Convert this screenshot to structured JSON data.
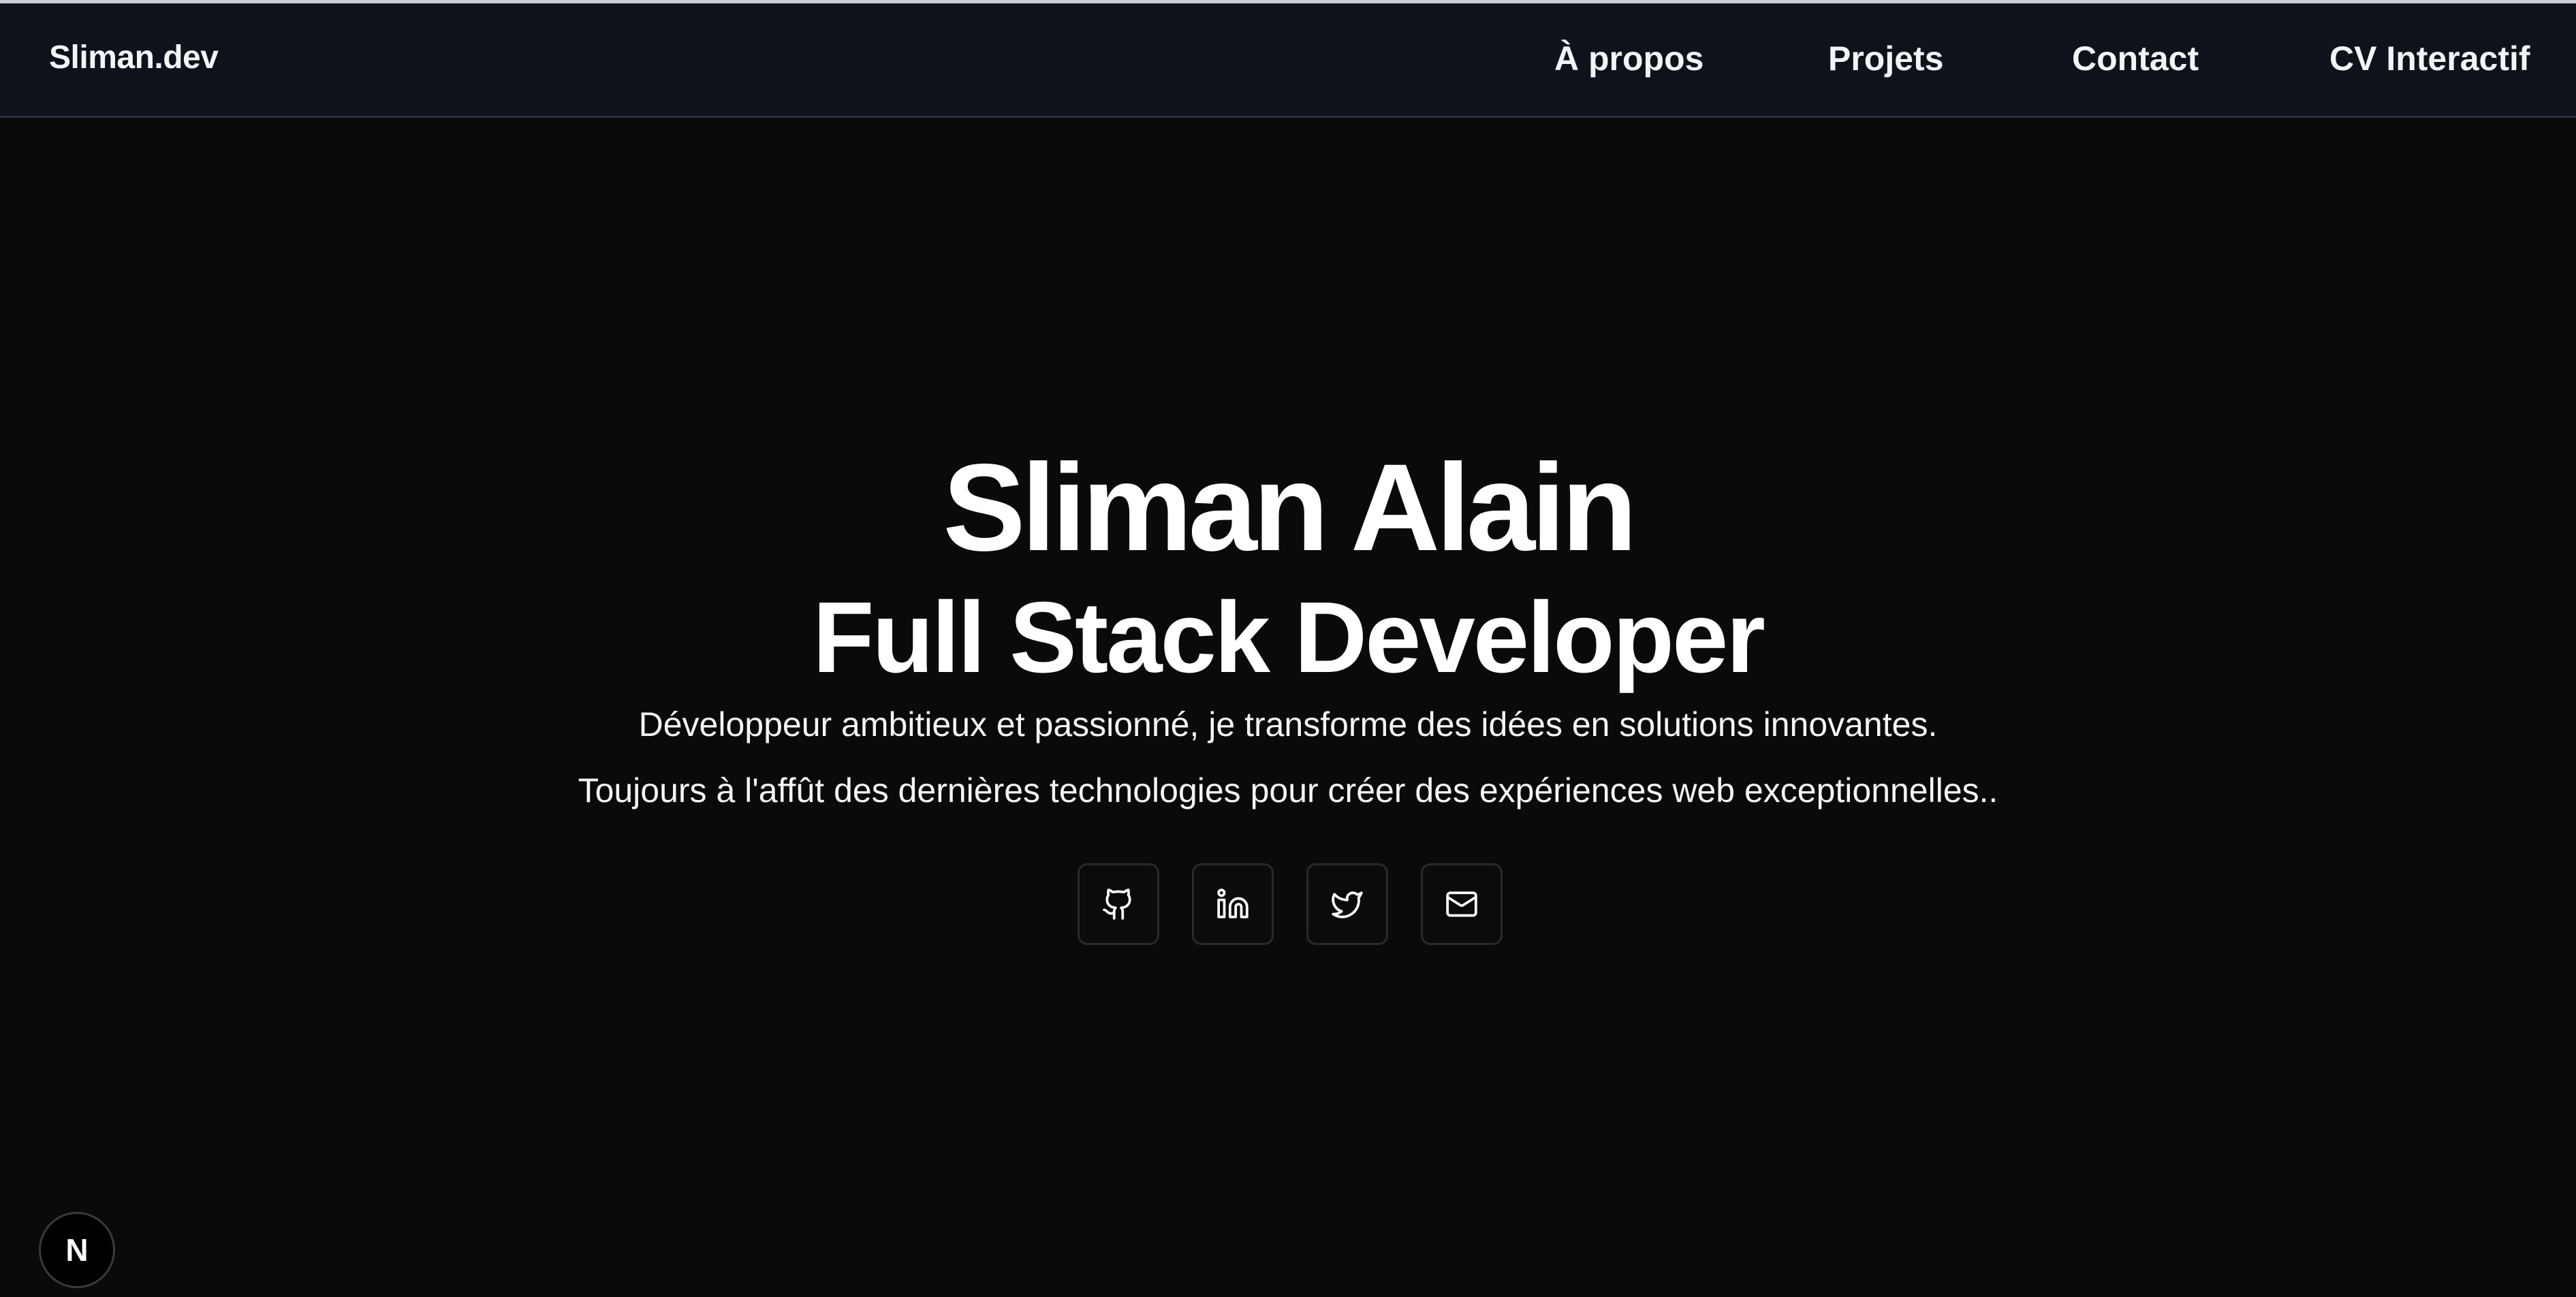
{
  "nav": {
    "brand": "Sliman.dev",
    "items": [
      {
        "label": "À propos"
      },
      {
        "label": "Projets"
      },
      {
        "label": "Contact"
      },
      {
        "label": "CV Interactif"
      }
    ]
  },
  "hero": {
    "name": "Sliman Alain",
    "role": "Full Stack Developer",
    "line1": "Développeur ambitieux et passionné, je transforme des idées en solutions innovantes.",
    "line2": "Toujours à l'affût des dernières technologies pour créer des expériences web exceptionnelles.."
  },
  "social": [
    {
      "icon": "github-icon"
    },
    {
      "icon": "linkedin-icon"
    },
    {
      "icon": "twitter-icon"
    },
    {
      "icon": "mail-icon"
    }
  ],
  "badge": {
    "letter": "N"
  },
  "colors": {
    "background": "#0a0a0a",
    "navbar": "#0d121b",
    "text": "#ffffff",
    "border": "#262a31"
  }
}
